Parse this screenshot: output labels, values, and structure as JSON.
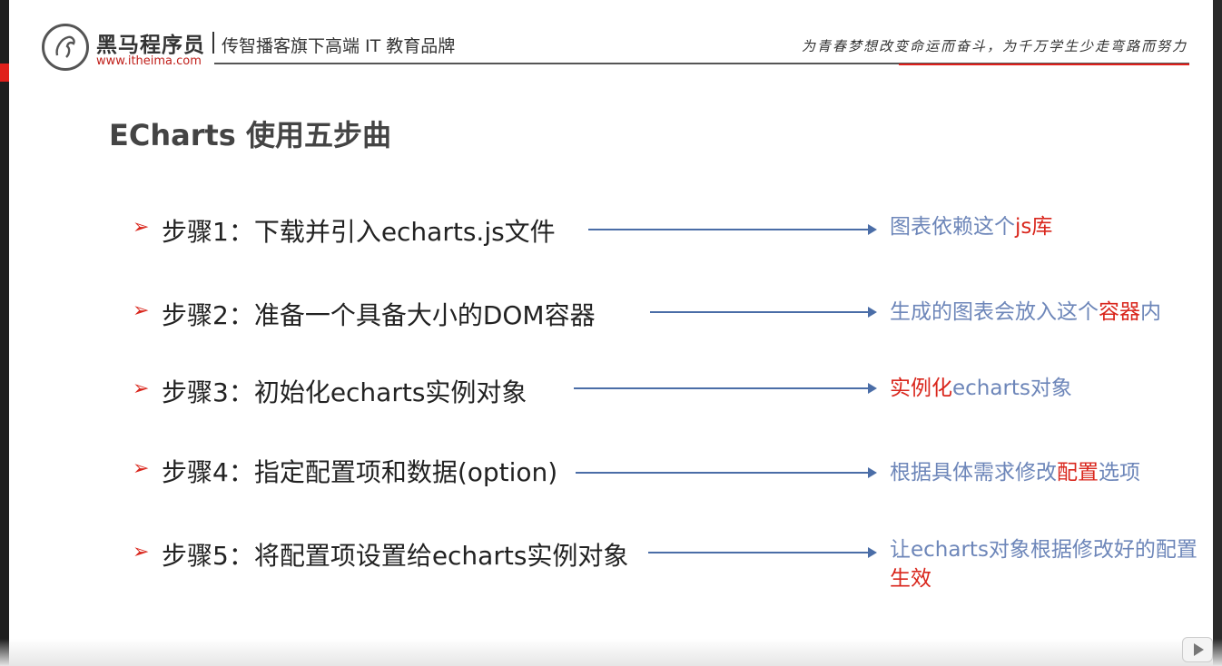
{
  "header": {
    "brand_name": "黑马程序员",
    "brand_url": "www.itheima.com",
    "slogan": "传智播客旗下高端 IT 教育品牌",
    "calligraphy": "为青春梦想改变命运而奋斗，为千万学生少走弯路而努力"
  },
  "slide": {
    "title": "ECharts 使用五步曲",
    "steps": [
      {
        "label": "步骤1：下载并引入echarts.js文件",
        "note_parts": [
          "图表依赖这个",
          "js库"
        ]
      },
      {
        "label": "步骤2：准备一个具备大小的DOM容器",
        "note_parts": [
          "生成的图表会放入这个",
          "容器",
          "内"
        ]
      },
      {
        "label": "步骤3：初始化echarts实例对象",
        "note_parts": [
          "实例化",
          "echarts对象"
        ]
      },
      {
        "label": "步骤4：指定配置项和数据(option)",
        "note_parts": [
          "根据具体需求修改",
          "配置",
          "选项"
        ]
      },
      {
        "label": "步骤5：将配置项设置给echarts实例对象",
        "note_parts": [
          "让echarts对象根据修改好的配置",
          "生效"
        ]
      }
    ],
    "step_marker": "➢"
  },
  "colors": {
    "accent_red": "#d9261c",
    "note_blue": "#6d86b9",
    "connector_blue": "#4a6da7"
  }
}
